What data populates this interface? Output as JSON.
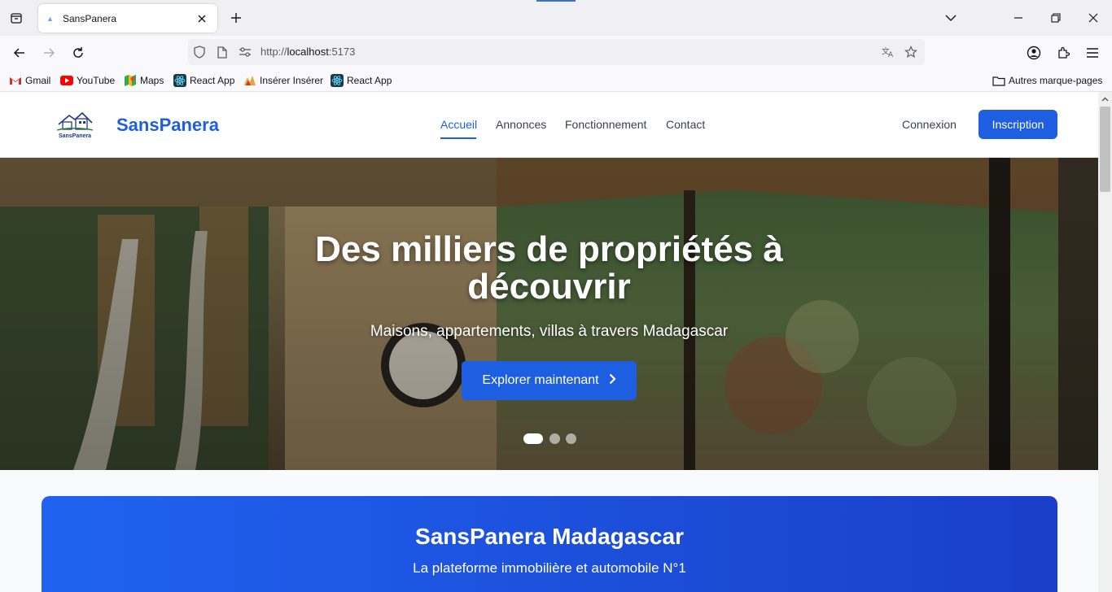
{
  "browser": {
    "tab_title": "SansPanera",
    "url_prefix": "http://",
    "url_host": "localhost",
    "url_port": ":5173",
    "bookmarks": [
      "Gmail",
      "YouTube",
      "Maps",
      "React App",
      "Insérer Insérer",
      "React App"
    ],
    "other_bookmarks": "Autres marque-pages"
  },
  "header": {
    "brand": "SansPanera",
    "logo_text": "SansPanera",
    "nav": [
      "Accueil",
      "Annonces",
      "Fonctionnement",
      "Contact"
    ],
    "active_nav": "Accueil",
    "login": "Connexion",
    "signup": "Inscription"
  },
  "hero": {
    "title": "Des milliers de propriétés à découvrir",
    "subtitle": "Maisons, appartements, villas à travers Madagascar",
    "cta": "Explorer maintenant",
    "slides_total": 3,
    "active_slide": 1
  },
  "promo": {
    "title": "SansPanera Madagascar",
    "subtitle": "La plateforme immobilière et automobile N°1"
  },
  "colors": {
    "accent": "#1d5fe0",
    "promo_start": "#1f63f0",
    "promo_end": "#1a3fc9"
  }
}
